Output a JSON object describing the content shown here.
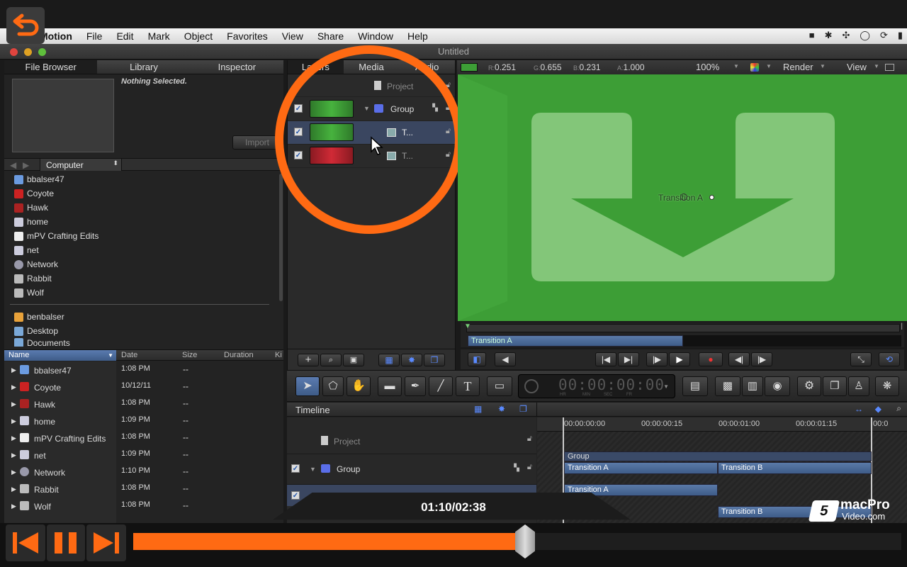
{
  "menubar": {
    "app": "Motion",
    "items": [
      "File",
      "Edit",
      "Mark",
      "Object",
      "Favorites",
      "View",
      "Share",
      "Window",
      "Help"
    ]
  },
  "window": {
    "title": "Untitled"
  },
  "left_tabs": [
    "File Browser",
    "Library",
    "Inspector"
  ],
  "preview": {
    "nothing_selected": "Nothing Selected.",
    "import_label": "Import",
    "location": "Computer"
  },
  "sidebar": {
    "devices": [
      "bbalser47",
      "Coyote",
      "Hawk",
      "home",
      "mPV Crafting Edits",
      "net",
      "Network",
      "Rabbit",
      "Wolf"
    ],
    "places": [
      "benbalser",
      "Desktop",
      "Documents"
    ]
  },
  "file_table": {
    "headers": [
      "Name",
      "Date",
      "Size",
      "Duration",
      "Ki"
    ],
    "rows": [
      {
        "name": "bbalser47",
        "date": "1:08 PM",
        "size": "--"
      },
      {
        "name": "Coyote",
        "date": "10/12/11",
        "size": "--"
      },
      {
        "name": "Hawk",
        "date": "1:08 PM",
        "size": "--"
      },
      {
        "name": "home",
        "date": "1:09 PM",
        "size": "--"
      },
      {
        "name": "mPV Crafting Edits",
        "date": "1:08 PM",
        "size": "--"
      },
      {
        "name": "net",
        "date": "1:09 PM",
        "size": "--"
      },
      {
        "name": "Network",
        "date": "1:10 PM",
        "size": "--"
      },
      {
        "name": "Rabbit",
        "date": "1:08 PM",
        "size": "--"
      },
      {
        "name": "Wolf",
        "date": "1:08 PM",
        "size": "--"
      }
    ]
  },
  "layers_tabs": [
    "Layers",
    "Media",
    "Audio"
  ],
  "layers": {
    "project": "Project",
    "group": "Group",
    "item1": "T...",
    "item2": "T..."
  },
  "canvas": {
    "r_label": "R:",
    "r": "0.251",
    "g_label": "G:",
    "g": "0.655",
    "b_label": "B:",
    "b": "0.231",
    "a_label": "A:",
    "a": "1.000",
    "zoom": "100%",
    "render": "Render",
    "view": "View",
    "overlay_label": "Transition A",
    "mini_clip": "Transition A"
  },
  "timecode": {
    "value": "00:00:00:00",
    "units": [
      "HR",
      "MIN",
      "SEC",
      "FR"
    ]
  },
  "timeline": {
    "title": "Timeline",
    "ruler": [
      "00:00:00:00",
      "00:00:00:15",
      "00:00:01:00",
      "00:00:01:15",
      "00:0"
    ],
    "project": "Project",
    "group": "Group",
    "clips": {
      "group": "Group",
      "ta1": "Transition A",
      "tb1": "Transition B",
      "ta2": "Transition A",
      "tb2": "Transition B"
    }
  },
  "player": {
    "time": "01:10/02:38",
    "progress": 0.51,
    "watermark_top": "macPro",
    "watermark_bottom": "Video.com"
  },
  "colors": {
    "accent": "#ff6a13",
    "canvas_green": "#3d9e36",
    "selection": "#3e5c88"
  }
}
